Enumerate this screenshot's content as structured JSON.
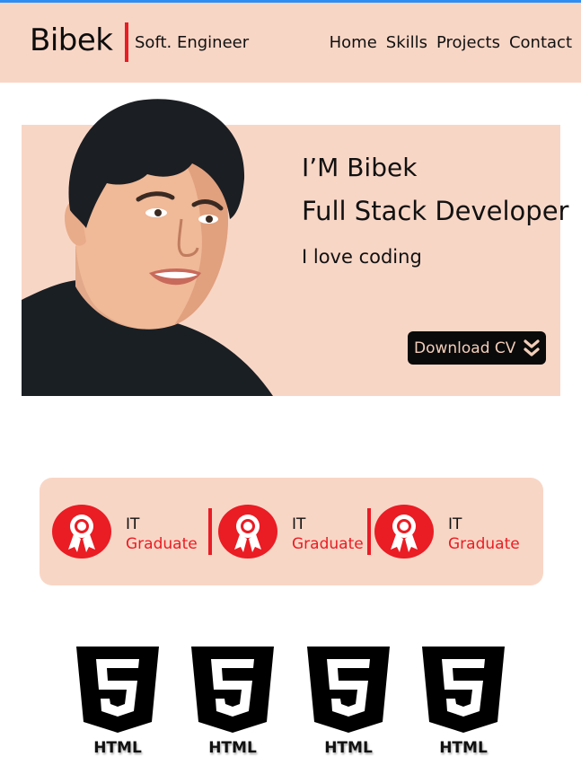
{
  "header": {
    "brand": "Bibek",
    "subtitle": "Soft. Engineer",
    "nav": [
      "Home",
      "Skills",
      "Projects",
      "Contact"
    ]
  },
  "hero": {
    "line1": "I’M Bibek",
    "line2": "Full Stack Developer",
    "line3": "I love coding",
    "cta_label": "Download CV"
  },
  "badges": [
    {
      "line1": "IT",
      "line2": "Graduate"
    },
    {
      "line1": "IT",
      "line2": "Graduate"
    },
    {
      "line1": "IT",
      "line2": "Graduate"
    }
  ],
  "skills": [
    {
      "label": "HTML",
      "icon": "html5-icon"
    },
    {
      "label": "HTML",
      "icon": "html5-icon"
    },
    {
      "label": "HTML",
      "icon": "html5-icon"
    },
    {
      "label": "HTML",
      "icon": "html5-icon"
    }
  ],
  "colors": {
    "accent": "#ea1c24",
    "peach": "#f8d6c6",
    "top_line": "#2f8ef4",
    "dark": "#0a0a0a"
  }
}
